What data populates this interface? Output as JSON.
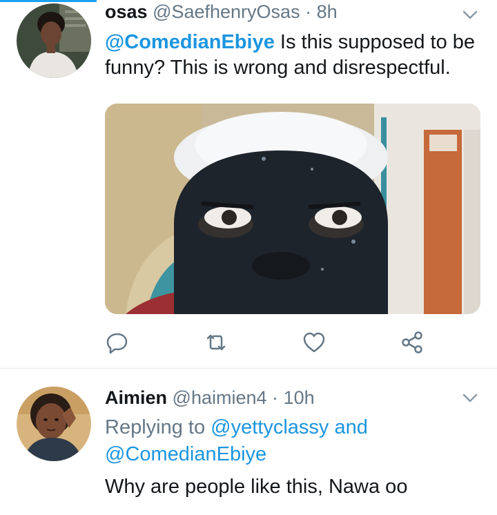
{
  "tweets": [
    {
      "name": "osas",
      "handle": "@SaefhenryOsas",
      "separator": "·",
      "time": "8h",
      "mention": "@ComedianEbiye",
      "text": " Is this supposed to be funny? This is wrong and disrespectful.",
      "avatar_icon": "profile-photo",
      "has_media": true,
      "actions": [
        "reply-icon",
        "retweet-icon",
        "like-icon",
        "share-icon"
      ]
    },
    {
      "name": "Aimien",
      "handle": "@haimien4",
      "separator": "·",
      "time": "10h",
      "replying_prefix": "Replying to ",
      "replying_user1": "@yettyclassy",
      "replying_and": " and",
      "replying_user2": "@ComedianEbiye",
      "text": "Why are people like this, Nawa oo",
      "avatar_icon": "profile-photo"
    }
  ],
  "colors": {
    "accent": "#1da1f2",
    "link": "#1b95e0",
    "muted": "#657786",
    "text": "#14171a",
    "divider": "#e1e8ed"
  }
}
